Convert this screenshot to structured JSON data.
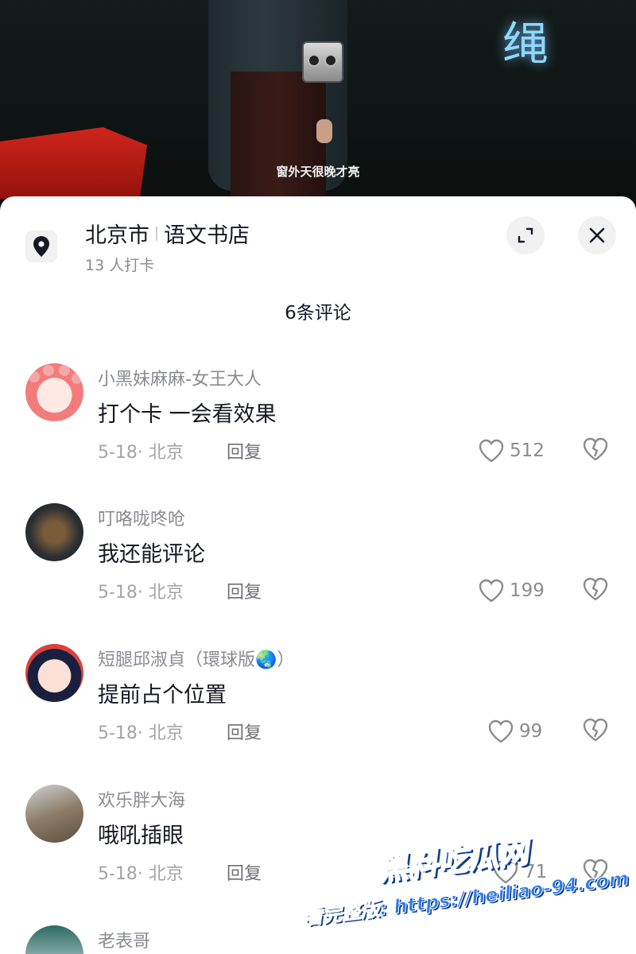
{
  "video": {
    "subtitle": "窗外天很晚才亮",
    "title_glyph": "绳"
  },
  "location": {
    "city": "北京市",
    "place": "语文书店",
    "checkins": "13 人打卡"
  },
  "comments_header": "6条评论",
  "comments": [
    {
      "name": "小黑妹麻麻-女王大人",
      "text": "打个卡 一会看效果",
      "meta": "5-18· 北京",
      "reply": "回复",
      "likes": "512"
    },
    {
      "name": "叮咯咙咚呛",
      "text": "我还能评论",
      "meta": "5-18· 北京",
      "reply": "回复",
      "likes": "199"
    },
    {
      "name": "短腿邱淑貞（環球版🌏）",
      "text": "提前占个位置",
      "meta": "5-18· 北京",
      "reply": "回复",
      "likes": "99"
    },
    {
      "name": "欢乐胖大海",
      "text": "哦吼插眼",
      "meta": "5-18· 北京",
      "reply": "回复",
      "likes": "71"
    },
    {
      "name": "老表哥",
      "text": "",
      "meta": "",
      "reply": "",
      "likes": ""
    }
  ],
  "watermark": {
    "brand": "黑料吃瓜网",
    "line": "看完整版: https://heiliao-94.com"
  },
  "colors": {
    "text_primary": "#161823",
    "text_secondary": "#8a8b91",
    "sheet_bg": "#ffffff",
    "button_bg": "#f1f1f2"
  },
  "icons": [
    "location-pin-icon",
    "expand-icon",
    "close-icon",
    "heart-icon",
    "broken-heart-icon"
  ]
}
